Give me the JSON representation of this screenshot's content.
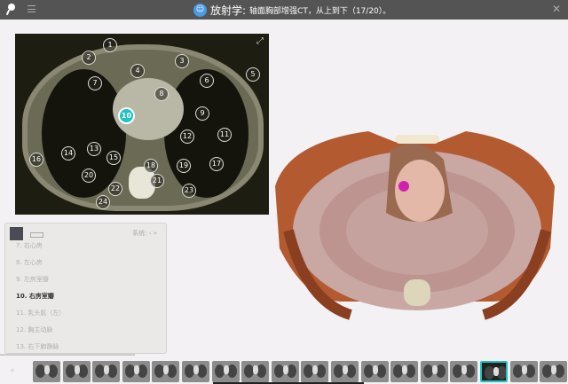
{
  "header": {
    "app_name": "放射学:",
    "subtitle": "轴面胸部增强CT，从上到下（17/20）。",
    "logo_icon": "app-logo-icon",
    "close": "✕"
  },
  "ct": {
    "markers": [
      "1",
      "2",
      "3",
      "4",
      "5",
      "6",
      "7",
      "8",
      "9",
      "10",
      "11",
      "12",
      "13",
      "14",
      "15",
      "16",
      "17",
      "18",
      "19",
      "20",
      "21",
      "22",
      "23",
      "24"
    ],
    "active_marker": "10",
    "expand": "⤢"
  },
  "panel": {
    "system_label": "系统:",
    "nav": "‹ »",
    "items": [
      "7. 右心房",
      "8. 左心房",
      "9. 左房室瓣",
      "10. 右房室瓣",
      "11. 乳头肌（左）",
      "12. 胸主动脉",
      "13. 右下肺静脉"
    ],
    "current": "10. 右房室瓣"
  },
  "strip": {
    "prev": "«",
    "thumb_count": 18,
    "active_index": 15
  }
}
